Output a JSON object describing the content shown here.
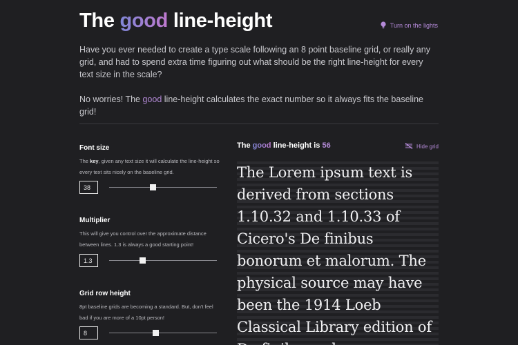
{
  "header": {
    "title_pre": "The",
    "title_accent": "good",
    "title_post": "line-height",
    "lights_label": "Turn on the lights"
  },
  "intro": {
    "paragraph1": "Have you ever needed to create a type scale following an 8 point baseline grid, or really any grid, and had to spend extra time figuring out what should be the right line-height for every text size in the scale?",
    "p2_pre": "No worries! The",
    "p2_accent": "good",
    "p2_post": "line-height calculates the exact number so it always fits the baseline grid!"
  },
  "controls": {
    "font_size": {
      "title": "Font size",
      "desc_pre": "The",
      "desc_key": "key",
      "desc_post": ", given any text size it will calculate the line-height so every text sits nicely on the baseline grid.",
      "value": "38",
      "slider_fraction": 0.41
    },
    "multiplier": {
      "title": "Multiplier",
      "desc": "This will give you control over the approximate distance between lines. 1.3 is always a good starting point!",
      "value": "1.3",
      "slider_fraction": 0.31
    },
    "grid_row_height": {
      "title": "Grid row height",
      "desc": "8pt baseline grids are becoming a standard. But, don't feel bad if you are more of a 10pt person!",
      "value": "8",
      "slider_fraction": 0.43
    }
  },
  "preview": {
    "head_pre": "The",
    "head_accent": "good",
    "head_post": "line-height is",
    "line_height_value": "56",
    "hide_grid_label": "Hide grid",
    "sample_text": "The Lorem ipsum text is derived from sections 1.10.32 and 1.10.33 of Cicero's De finibus bonorum et malorum. The physical source may have been the 1914 Loeb Classical Library edition of De finibus, where"
  },
  "colors": {
    "background": "#1f1f22",
    "accent": "#b38ad6",
    "gradient_start": "#7f86d6",
    "gradient_end": "#c07ad0",
    "grid_stripe": "#2b2b2f"
  },
  "icons": {
    "lights": "lightbulb-icon",
    "hide_grid": "grid-off-icon"
  }
}
